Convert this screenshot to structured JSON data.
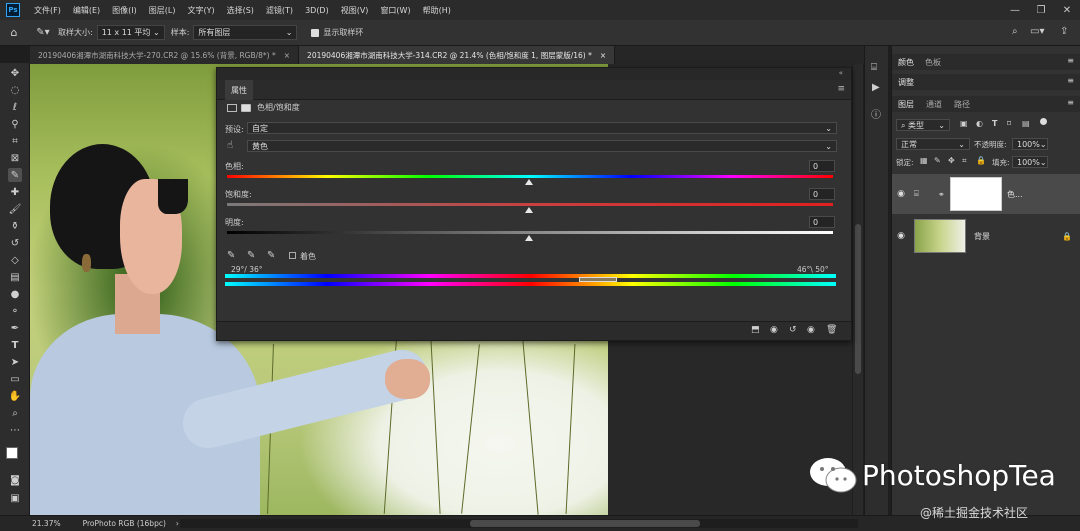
{
  "menu": {
    "items": [
      "文件(F)",
      "编辑(E)",
      "图像(I)",
      "图层(L)",
      "文字(Y)",
      "选择(S)",
      "滤镜(T)",
      "3D(D)",
      "视图(V)",
      "窗口(W)",
      "帮助(H)"
    ]
  },
  "options": {
    "sample_size_label": "取样大小:",
    "sample_size_value": "11 x 11 平均",
    "sample_label": "样本:",
    "sample_value": "所有图层",
    "show_ring_label": "显示取样环"
  },
  "tabs": [
    {
      "label": "20190406湘潭市湖南科技大学-270.CR2 @ 15.6% (背景, RGB/8*) *",
      "active": false
    },
    {
      "label": "20190406湘潭市湖南科技大学-314.CR2 @ 21.4% (色相/饱和度 1, 图层蒙版/16) *",
      "active": true
    }
  ],
  "properties": {
    "tab_label": "属性",
    "adjustment_name": "色相/饱和度",
    "preset_label": "预设:",
    "preset_value": "自定",
    "channel_value": "黄色",
    "hue_label": "色相:",
    "hue_value": "0",
    "saturation_label": "饱和度:",
    "saturation_value": "0",
    "lightness_label": "明度:",
    "lightness_value": "0",
    "colorize_label": "着色",
    "range_left": "29°/ 36°",
    "range_right": "46°\\ 50°"
  },
  "right_panel": {
    "tabs_top": [
      "颜色",
      "色板"
    ],
    "tab_adjust": "调整",
    "tabs_layers": [
      "图层",
      "通道",
      "路径"
    ],
    "kind_value": "类型",
    "blend_value": "正常",
    "opacity_label": "不透明度:",
    "opacity_value": "100%",
    "lock_label": "锁定:",
    "fill_label": "填充:",
    "fill_value": "100%",
    "layer1_name": "色...",
    "layer2_name": "背景"
  },
  "status": {
    "zoom": "21.37%",
    "profile": "ProPhoto RGB (16bpc)"
  },
  "watermark": {
    "text": "PhotoshopTea",
    "sub": "@稀土掘金技术社区"
  },
  "colors": {
    "accent": "#2fa3f7",
    "panel": "#323232",
    "menubar": "#2b2b2b"
  }
}
